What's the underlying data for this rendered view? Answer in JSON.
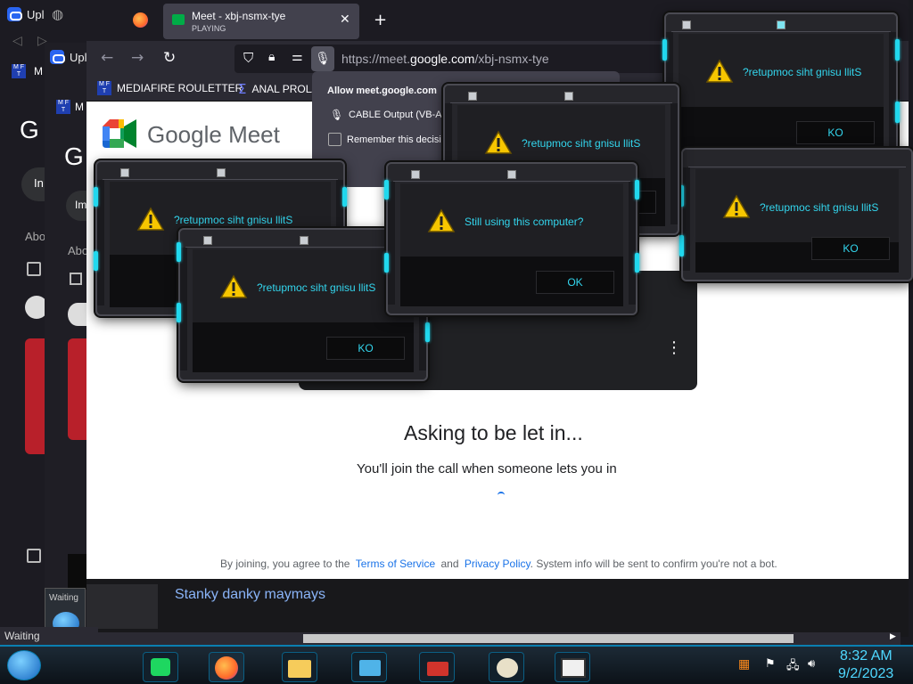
{
  "back_window_1": {
    "tab_label": "Upl",
    "bookmark_label": "M"
  },
  "back_window_2": {
    "tab_label": "Upl",
    "bookmark_label": "M"
  },
  "left_sidebar": {
    "google_g": "G",
    "chip": "In",
    "section": "Abo"
  },
  "left_sidebar_2": {
    "google_g": "G",
    "chip": "Im",
    "section": "Abo"
  },
  "main_tab": {
    "title": "Meet - xbj-nsmx-tye",
    "subtitle": "PLAYING"
  },
  "address": {
    "prefix": "https://meet.",
    "domain": "google.com",
    "path": "/xbj-nsmx-tye"
  },
  "bookmarks": [
    {
      "label": "MEDIAFIRE ROULETTER"
    },
    {
      "label": "ANAL PROLA"
    }
  ],
  "permission_popup": {
    "title": "Allow meet.google.com",
    "device": "CABLE Output (VB-Au",
    "remember": "Remember this decisio"
  },
  "meet": {
    "brand": "Google Meet",
    "heading": "Asking to be let in...",
    "subheading": "You'll join the call when someone lets you in",
    "footer_pre": "By joining, you agree to the",
    "terms": "Terms of Service",
    "and": "and",
    "privacy": "Privacy Policy",
    "footer_post": ". System info will be sent to confirm you're not a bot."
  },
  "below_content": {
    "video_title": "Stanky danky maymays",
    "thumb_label": "Waiting"
  },
  "status_text": "Waiting",
  "dialogs": [
    {
      "message": "?retupmoc siht gnisu llitS",
      "button": "KO"
    },
    {
      "message": "?retupmoc siht gnisu llitS",
      "button": "KO"
    },
    {
      "message": "?retupmoc siht gnisu llitS",
      "button": "KO"
    },
    {
      "message": "?retupmoc siht gnisu llitS",
      "button": "KO"
    },
    {
      "message": "?retupmoc siht gnisu llitS",
      "button": "KO"
    },
    {
      "message": "Still using this computer?",
      "button": "OK"
    }
  ],
  "clock": {
    "time": "8:32 AM",
    "date": "9/2/2023"
  },
  "colors": {
    "accent_cyan": "#33d6ee",
    "meet_blue": "#1a73e8",
    "taskbar_border": "#0a7fb0"
  }
}
